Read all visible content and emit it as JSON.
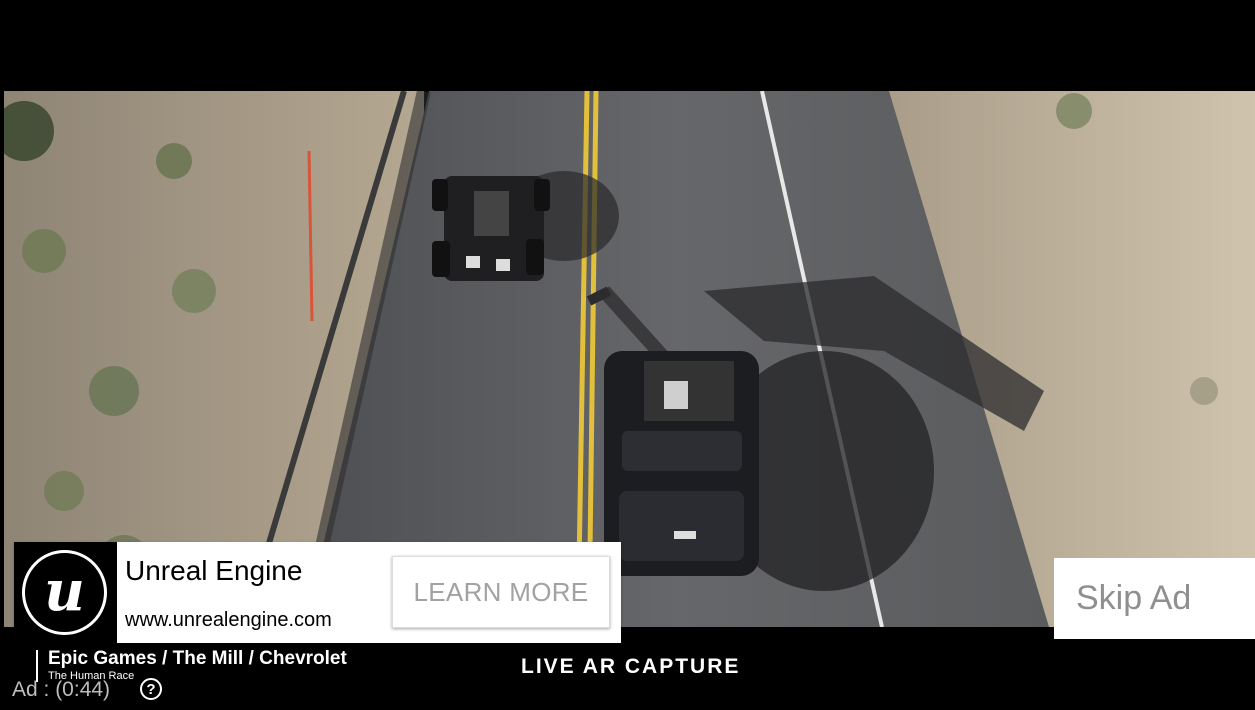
{
  "ad": {
    "advertiser": "Unreal Engine",
    "url": "www.unrealengine.com",
    "cta_label": "LEARN MORE",
    "logo_glyph": "u",
    "logo_icon": "unreal-engine-logo-icon"
  },
  "skip": {
    "label": "Skip Ad"
  },
  "video": {
    "credit": "Epic Games / The Mill / Chevrolet",
    "credit_sub": "The Human Race",
    "caption": "LIVE AR CAPTURE"
  },
  "player": {
    "ad_timer": "Ad : (0:44)",
    "help_glyph": "?",
    "help_icon": "help-icon"
  },
  "colors": {
    "road": "#5b5b5d",
    "terrain": "#b9aa94",
    "lane_yellow": "#e2c03c",
    "lane_white": "#e8e8e8"
  }
}
